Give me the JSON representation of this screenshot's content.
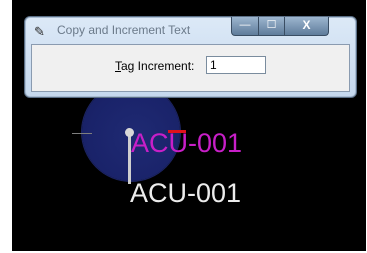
{
  "dialog": {
    "title": "Copy and Increment Text",
    "title_icon": "pin-icon",
    "buttons": {
      "minimize": "—",
      "maximize": "☐",
      "close": "X"
    },
    "field": {
      "label_accel": "T",
      "label_rest": "ag Increment:",
      "value": "1"
    }
  },
  "canvas": {
    "tags": {
      "active": "ACU-001",
      "static": "ACU-001"
    },
    "colors": {
      "active_tag": "#c81fc8",
      "static_tag": "#ececec",
      "background": "#000000",
      "marker": "#e0121b"
    }
  }
}
